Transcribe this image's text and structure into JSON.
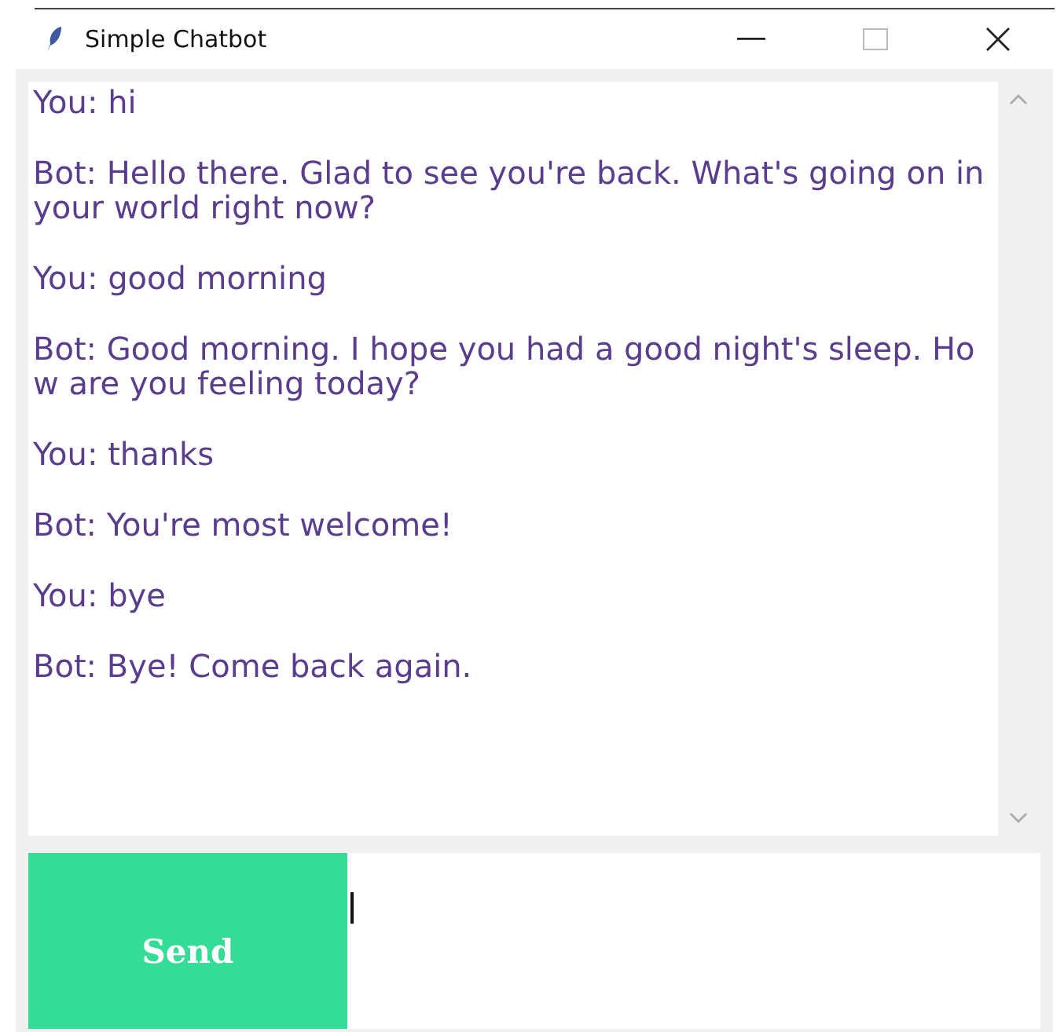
{
  "window": {
    "title": "Simple Chatbot"
  },
  "messages": [
    {
      "text": "You: hi"
    },
    {
      "text": "Bot: Hello there. Glad to see you're back. What's going on in your world right now?"
    },
    {
      "text": "You: good morning"
    },
    {
      "text": "Bot: Good morning. I hope you had a good night's sleep. How are you feeling today?"
    },
    {
      "text": "You: thanks"
    },
    {
      "text": "Bot: You're most welcome!"
    },
    {
      "text": "You: bye"
    },
    {
      "text": "Bot: Bye! Come back again."
    }
  ],
  "send_button": {
    "label": "Send"
  }
}
